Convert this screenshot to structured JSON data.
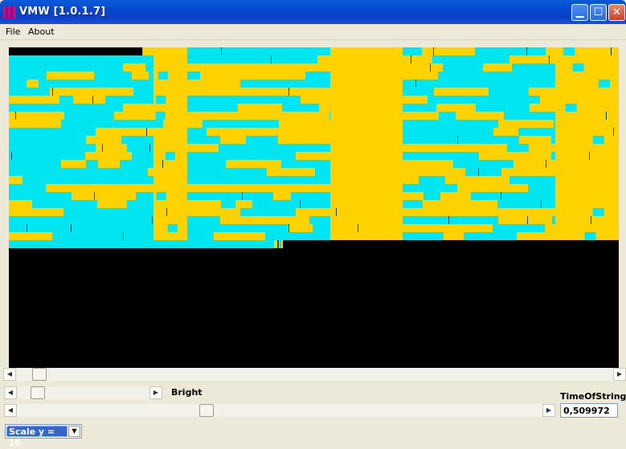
{
  "window": {
    "title": "VMW [1.0.1.7]"
  },
  "title_buttons": {
    "minimize": "▁",
    "maximize": "☐",
    "close": "✕"
  },
  "menu": {
    "file": "File",
    "about": "About"
  },
  "colors": {
    "cyan": "#00e5f0",
    "gold": "#ffd200",
    "black": "#000000",
    "blue_marker": "#1540c8",
    "green_marker": "#40d080"
  },
  "scrollbars": {
    "left_arrow": "◀",
    "right_arrow": "▶"
  },
  "controls": {
    "bright_label": "Bright",
    "time_label": "TimeOfString",
    "time_value": "0,509972",
    "scale_selected": "Scale y = 10",
    "scale_arrow": "▼"
  },
  "icons": {
    "app": "app-icon",
    "minimize": "minimize-icon",
    "maximize": "maximize-icon",
    "close": "close-icon",
    "left_arrow": "arrow-left-icon",
    "right_arrow": "arrow-right-icon",
    "dropdown": "chevron-down-icon"
  }
}
